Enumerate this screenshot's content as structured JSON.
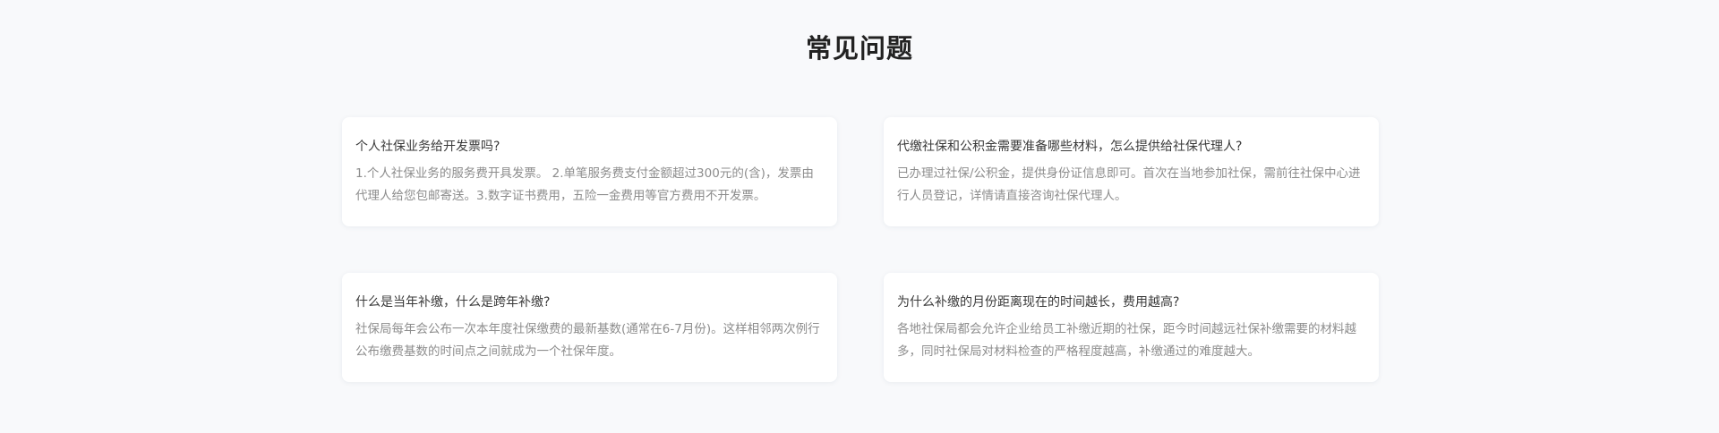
{
  "section": {
    "title": "常见问题"
  },
  "faqs": [
    {
      "question": "个人社保业务给开发票吗?",
      "answer": "1.个人社保业务的服务费开具发票。 2.单笔服务费支付金额超过300元的(含)，发票由代理人给您包邮寄送。3.数字证书费用，五险一金费用等官方费用不开发票。"
    },
    {
      "question": "代缴社保和公积金需要准备哪些材料，怎么提供给社保代理人?",
      "answer": "已办理过社保/公积金，提供身份证信息即可。首次在当地参加社保，需前往社保中心进行人员登记，详情请直接咨询社保代理人。"
    },
    {
      "question": "什么是当年补缴，什么是跨年补缴?",
      "answer": "社保局每年会公布一次本年度社保缴费的最新基数(通常在6-7月份)。这样相邻两次例行公布缴费基数的时间点之间就成为一个社保年度。"
    },
    {
      "question": "为什么补缴的月份距离现在的时间越长，费用越高?",
      "answer": "各地社保局都会允许企业给员工补缴近期的社保，距今时间越远社保补缴需要的材料越多，同时社保局对材料检查的严格程度越高，补缴通过的难度越大。"
    }
  ]
}
